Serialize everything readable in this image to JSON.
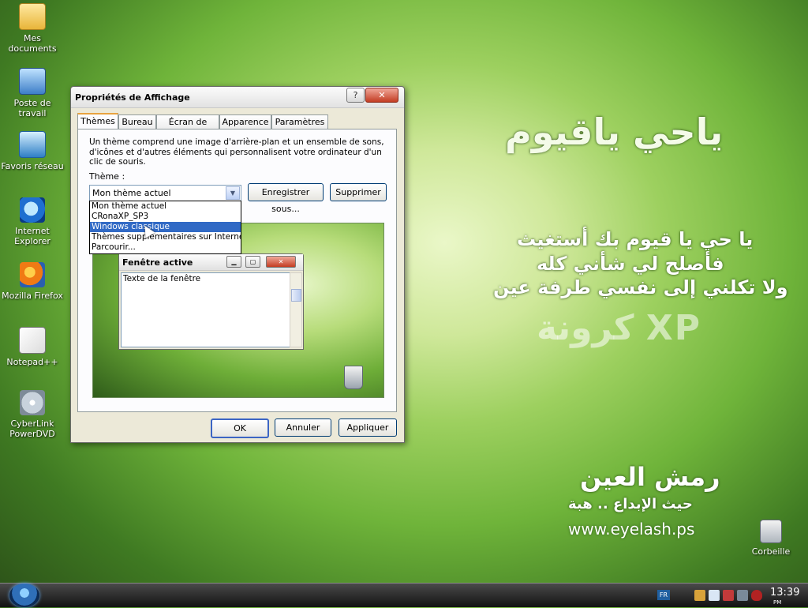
{
  "desktop": {
    "icons": [
      {
        "label": "Mes documents"
      },
      {
        "label": "Poste de travail"
      },
      {
        "label": "Favoris réseau"
      },
      {
        "label": "Internet Explorer"
      },
      {
        "label": "Mozilla Firefox"
      },
      {
        "label": "Notepad++"
      },
      {
        "label": "CyberLink PowerDVD"
      },
      {
        "label": "Corbeille"
      }
    ],
    "wallpaper": {
      "title_ar": "ياحي ياقيوم",
      "line1": "يا حي يا قيوم بك أستغيث",
      "line2": "فأصلح لي شأني كله",
      "line3": "ولا تكلني إلى نفسي طرفة عين",
      "brand": "كرونة XP",
      "logo_ar": "رمش العين",
      "slogan_ar": "حيث الإبداع .. هبة",
      "url": "www.eyelash.ps"
    }
  },
  "dialog": {
    "title": "Propriétés de Affichage",
    "help_label": "?",
    "close_label": "✕",
    "tabs": [
      "Thèmes",
      "Bureau",
      "Écran de veille",
      "Apparence",
      "Paramètres"
    ],
    "description": "Un thème comprend une image d'arrière-plan et un ensemble de sons, d'icônes et d'autres éléments qui personnalisent votre ordinateur d'un clic de souris.",
    "theme_label": "Thème :",
    "theme_value": "Mon thème actuel",
    "save_label": "Enregistrer sous...",
    "delete_label": "Supprimer",
    "dropdown": [
      "Mon thème actuel",
      "CRonaXP_SP3",
      "Windows classique",
      "Thèmes supplémentaires sur Internet...",
      "Parcourir..."
    ],
    "preview": {
      "window_title": "Fenêtre active",
      "window_text": "Texte de la fenêtre"
    },
    "ok_label": "OK",
    "cancel_label": "Annuler",
    "apply_label": "Appliquer"
  },
  "taskbar": {
    "language": "FR",
    "clock_time": "13:39",
    "clock_ampm": "PM"
  },
  "colors": {
    "selection": "#316ac5",
    "dialog_bg": "#ece9d8",
    "close_red": "#c33c22"
  },
  "icons": {
    "start": "windows-orb-icon",
    "help": "question-mark",
    "close": "x-mark"
  }
}
